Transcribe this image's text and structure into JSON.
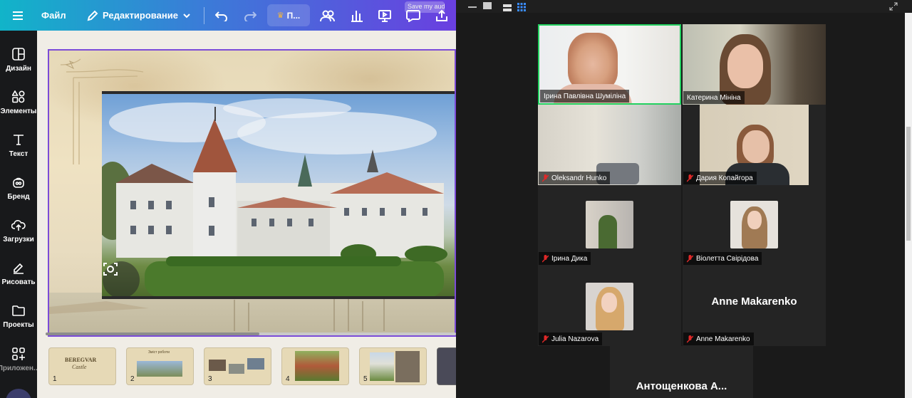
{
  "canva": {
    "topbar": {
      "file_label": "Файл",
      "edit_label": "Редактирование",
      "pro_label": "П...",
      "tooltip": "Save my audio"
    },
    "sidebar": [
      {
        "label": "Дизайн",
        "icon": "layout-icon"
      },
      {
        "label": "Элементы",
        "icon": "shapes-icon"
      },
      {
        "label": "Текст",
        "icon": "text-icon"
      },
      {
        "label": "Бренд",
        "icon": "brand-icon"
      },
      {
        "label": "Загрузки",
        "icon": "upload-icon"
      },
      {
        "label": "Рисовать",
        "icon": "draw-icon"
      },
      {
        "label": "Проекты",
        "icon": "folder-icon"
      },
      {
        "label": "Приложен...",
        "icon": "apps-icon"
      }
    ],
    "pages": [
      {
        "num": "1",
        "title": "BEREGVAR",
        "subtitle": "Castle"
      },
      {
        "num": "2",
        "title": "Зміст роботи"
      },
      {
        "num": "3"
      },
      {
        "num": "4"
      },
      {
        "num": "5"
      }
    ],
    "accent": "#7b4bd8"
  },
  "zoom": {
    "participants": [
      {
        "name": "Ірина Павлівна Шуміліна",
        "active": true,
        "muted": false
      },
      {
        "name": "Катерина Мініна",
        "active": false,
        "muted": false
      },
      {
        "name": "Oleksandr Hunko",
        "active": false,
        "muted": true
      },
      {
        "name": "Дария Копайгора",
        "active": false,
        "muted": true
      },
      {
        "name": "Ірина Дика",
        "active": false,
        "muted": true
      },
      {
        "name": "Віолетта Свірідова",
        "active": false,
        "muted": true
      },
      {
        "name": "Julia Nazarova",
        "active": false,
        "muted": true
      },
      {
        "name": "Anne Makarenko",
        "active": false,
        "muted": true,
        "big": "Anne Makarenko"
      },
      {
        "big": "Антощенкова  А..."
      }
    ],
    "active_color": "#23d160",
    "muted_color": "#e02828"
  }
}
